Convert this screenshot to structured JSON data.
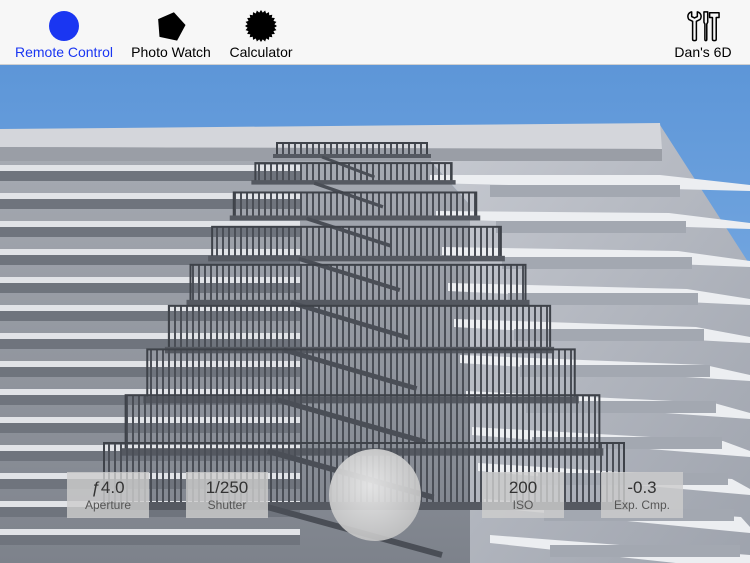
{
  "tabs": [
    {
      "label": "Remote Control",
      "icon": "circle-icon",
      "active": true
    },
    {
      "label": "Photo Watch",
      "icon": "pentagon-icon",
      "active": false
    },
    {
      "label": "Calculator",
      "icon": "seal-icon",
      "active": false
    }
  ],
  "camera": {
    "label": "Dan's 6D",
    "icon": "tools-icon"
  },
  "controls": {
    "aperture": {
      "value": "ƒ4.0",
      "label": "Aperture"
    },
    "shutter": {
      "value": "1/250",
      "label": "Shutter"
    },
    "iso": {
      "value": "200",
      "label": "ISO"
    },
    "exposure": {
      "value": "-0.3",
      "label": "Exp. Cmp."
    }
  },
  "colors": {
    "accent": "#1a36f2",
    "sky": "#6ea3dd",
    "facade": "#b9bcc4",
    "fire_escape": "#5b5f67"
  }
}
